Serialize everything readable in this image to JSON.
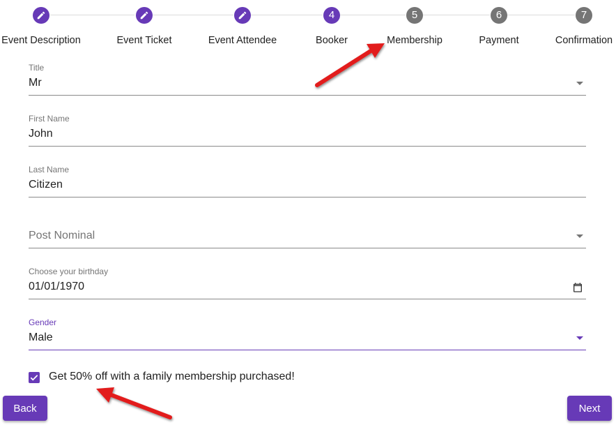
{
  "stepper": {
    "steps": [
      {
        "label": "Event Description",
        "number": "",
        "state": "done"
      },
      {
        "label": "Event Ticket",
        "number": "",
        "state": "done"
      },
      {
        "label": "Event Attendee",
        "number": "",
        "state": "done"
      },
      {
        "label": "Booker",
        "number": "4",
        "state": "current"
      },
      {
        "label": "Membership",
        "number": "5",
        "state": "pending"
      },
      {
        "label": "Payment",
        "number": "6",
        "state": "pending"
      },
      {
        "label": "Confirmation",
        "number": "7",
        "state": "pending"
      }
    ]
  },
  "form": {
    "title": {
      "label": "Title",
      "value": "Mr"
    },
    "first_name": {
      "label": "First Name",
      "value": "John"
    },
    "last_name": {
      "label": "Last Name",
      "value": "Citizen"
    },
    "post_nominal": {
      "placeholder": "Post Nominal"
    },
    "birthday": {
      "label": "Choose your birthday",
      "value": "01/01/1970"
    },
    "gender": {
      "label": "Gender",
      "value": "Male"
    },
    "membership_checkbox": {
      "label": "Get 50% off with  a family membership purchased!",
      "checked": true
    }
  },
  "buttons": {
    "back": "Back",
    "next": "Next"
  },
  "colors": {
    "accent": "#673ab7",
    "inactive_step": "#757575",
    "annotation_arrow": "#e21b1b"
  },
  "icons": {
    "done_step": "pencil-icon",
    "dropdown": "caret-down-icon",
    "date": "calendar-icon",
    "checkbox": "check-icon"
  }
}
